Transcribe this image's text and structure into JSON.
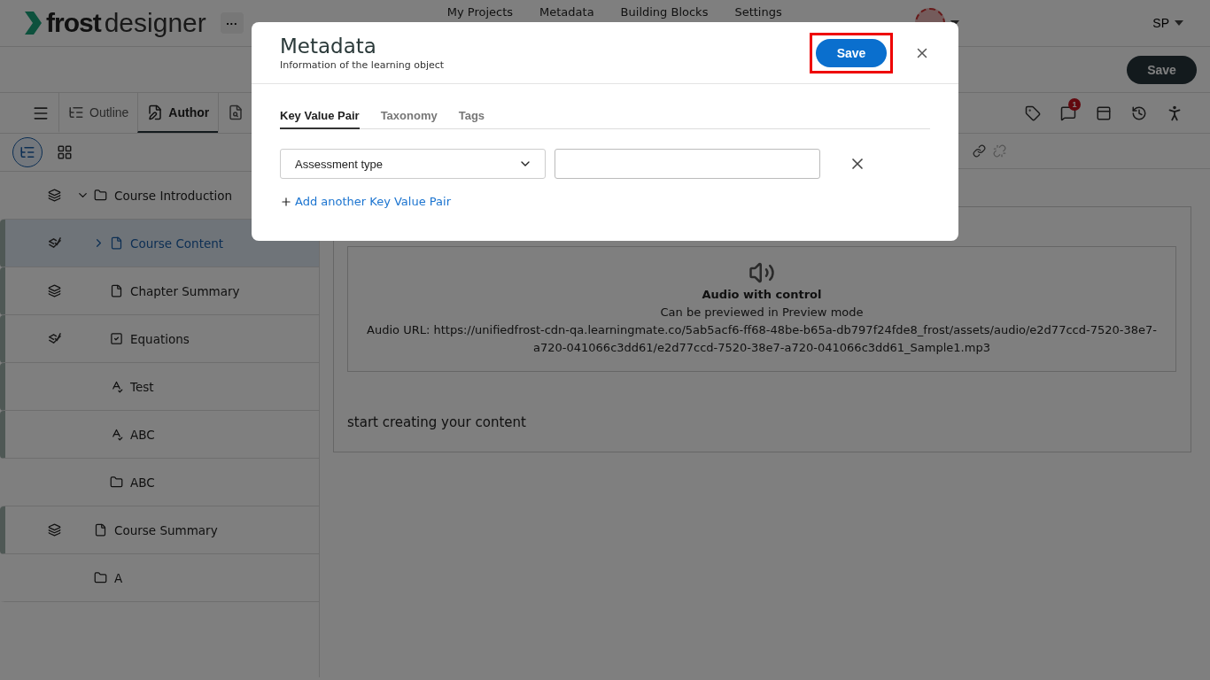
{
  "header": {
    "logo_bold": "frost",
    "logo_light": "designer",
    "more": "···",
    "nav": [
      "My Projects",
      "Metadata",
      "Building Blocks",
      "Settings"
    ],
    "user": "SP"
  },
  "subheader": {
    "save": "Save"
  },
  "toolbar": {
    "tabs": [
      {
        "kind": "outline",
        "label": "Outline",
        "selected": false
      },
      {
        "kind": "author",
        "label": "Author",
        "selected": true
      },
      {
        "kind": "preview",
        "selected": false
      }
    ],
    "notification_count": "1"
  },
  "view_switch": [
    {
      "kind": "tree",
      "selected": true
    },
    {
      "kind": "grid",
      "selected": false
    }
  ],
  "tree": [
    {
      "label": "Course Introduction",
      "kind": "folder",
      "layered": true,
      "checked": false,
      "expanded": true,
      "selected": false,
      "marked": false,
      "children": [
        {
          "label": "Course Content",
          "kind": "page",
          "layered": true,
          "checked": true,
          "expanded": false,
          "selected": true,
          "marked": true
        },
        {
          "label": "Chapter Summary",
          "kind": "page",
          "layered": true,
          "checked": false,
          "selected": false,
          "marked": true
        },
        {
          "label": "Equations",
          "kind": "checklist",
          "layered": true,
          "checked": true,
          "selected": false,
          "marked": true
        },
        {
          "label": "Test",
          "kind": "spelling",
          "layered": false,
          "selected": false,
          "marked": true
        },
        {
          "label": "ABC",
          "kind": "spelling",
          "layered": false,
          "selected": false,
          "marked": true
        },
        {
          "label": "ABC",
          "kind": "folder",
          "layered": false,
          "selected": false,
          "marked": false
        }
      ]
    },
    {
      "label": "Course Summary",
      "kind": "page",
      "layered": true,
      "checked": false,
      "selected": false,
      "marked": true
    },
    {
      "label": "A",
      "kind": "folder",
      "layered": false,
      "selected": false,
      "marked": false
    }
  ],
  "content": {
    "audio_title": "Audio with control",
    "audio_note": "Can be previewed in Preview mode",
    "audio_url": "Audio URL: https://unifiedfrost-cdn-qa.learningmate.co/5ab5acf6-ff68-48be-b65a-db797f24fde8_frost/assets/audio/e2d77ccd-7520-38e7-a720-041066c3dd61/e2d77ccd-7520-38e7-a720-041066c3dd61_Sample1.mp3",
    "placeholder": "start creating your content"
  },
  "modal": {
    "title": "Metadata",
    "subtitle": "Information of the learning object",
    "save": "Save",
    "save_highlighted": true,
    "tabs": [
      {
        "label": "Key Value Pair",
        "selected": true
      },
      {
        "label": "Taxonomy",
        "selected": false
      },
      {
        "label": "Tags",
        "selected": false
      }
    ],
    "pairs": [
      {
        "key": "Assessment type"
      }
    ],
    "add_link": "Add another Key Value Pair"
  }
}
